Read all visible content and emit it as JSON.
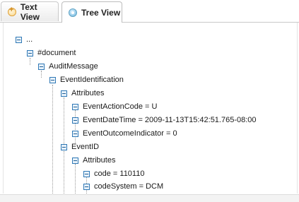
{
  "tabs": [
    {
      "label": "Text View",
      "icon": "add-icon",
      "active": false
    },
    {
      "label": "Tree View",
      "icon": "tree-view-icon",
      "active": true
    }
  ],
  "tree": [
    {
      "label": "..."
    },
    {
      "label": "#document"
    },
    {
      "label": "AuditMessage"
    },
    {
      "label": "EventIdentification"
    },
    {
      "label": "Attributes"
    },
    {
      "label": "EventActionCode = U"
    },
    {
      "label": "EventDateTime = 2009-11-13T15:42:51.765-08:00"
    },
    {
      "label": "EventOutcomeIndicator = 0"
    },
    {
      "label": "EventID"
    },
    {
      "label": "Attributes"
    },
    {
      "label": "code = 110110"
    },
    {
      "label": "codeSystem = DCM"
    }
  ],
  "colors": {
    "toggle_border": "#2f78b5",
    "tab_border": "#c9c9c9",
    "guide_line": "#9a9a9a"
  }
}
